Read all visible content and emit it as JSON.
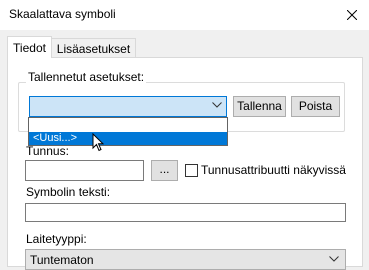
{
  "window": {
    "title": "Skaalattava symboli"
  },
  "tabs": [
    {
      "label": "Tiedot",
      "active": true
    },
    {
      "label": "Lisäasetukset",
      "active": false
    }
  ],
  "saved_settings": {
    "label": "Tallennetut asetukset:",
    "combo_value": "",
    "options": [
      "",
      "<Uusi...>"
    ],
    "highlighted_option": "<Uusi...>",
    "save_label": "Tallenna",
    "delete_label": "Poista"
  },
  "name_field": {
    "label": "Tunnus:",
    "value": "",
    "browse_label": "...",
    "visible_checkbox_label": "Tunnusattribuutti näkyvissä",
    "visible_checked": false
  },
  "symbol_text": {
    "label": "Symbolin teksti:",
    "value": ""
  },
  "device_type": {
    "label": "Laitetyyppi:",
    "value": "Tuntematon"
  },
  "colors": {
    "accent": "#0078d7",
    "combo_focus_bg": "#cce4f7"
  }
}
